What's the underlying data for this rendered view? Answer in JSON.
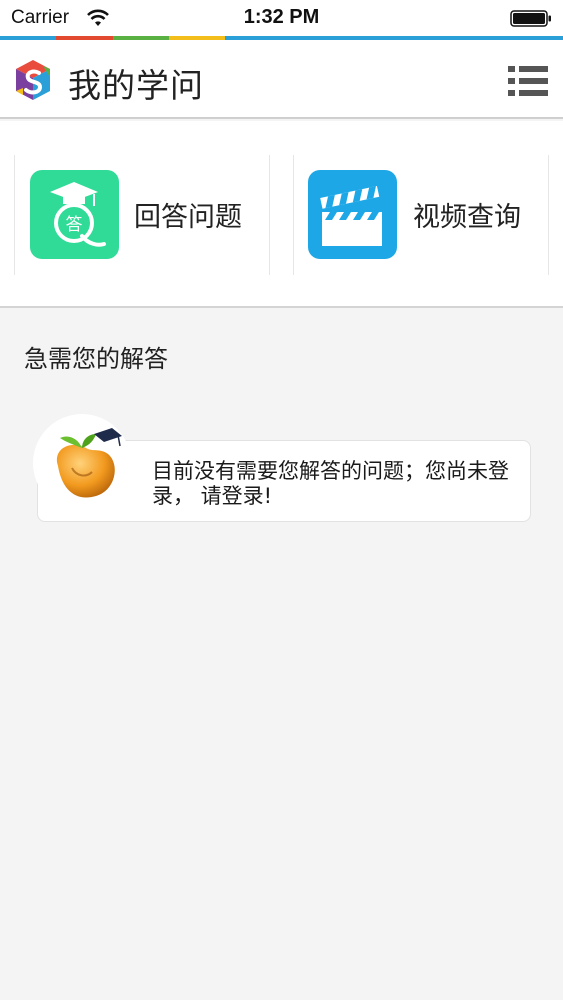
{
  "status_bar": {
    "carrier": "Carrier",
    "time": "1:32 PM",
    "wifi_icon": "wifi-icon",
    "battery_icon": "battery-icon"
  },
  "colors": {
    "strip": [
      "#2b9fd8",
      "#e2492f",
      "#59b144",
      "#f4be1a",
      "#2b9fd8"
    ],
    "answer_icon_bg": "#2fdb97",
    "video_icon_bg": "#1ea7e6"
  },
  "header": {
    "title": "我的学问",
    "logo_icon": "app-logo-icon",
    "menu_icon": "list-menu-icon"
  },
  "features": [
    {
      "label": "回答问题",
      "icon": "graduation-answer-icon"
    },
    {
      "label": "视频查询",
      "icon": "clapperboard-icon"
    }
  ],
  "section": {
    "title": "急需您的解答"
  },
  "empty_state": {
    "message": "目前没有需要您解答的问题；您尚未登录， 请登录!",
    "mascot_icon": "bean-mascot-icon"
  }
}
